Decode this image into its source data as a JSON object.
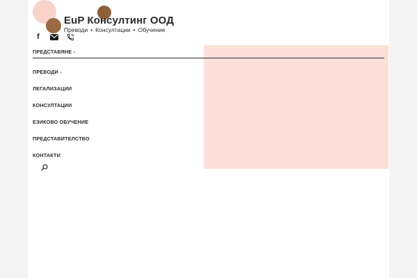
{
  "brand": {
    "title": "EuP Консултинг ООД",
    "tagline_parts": [
      "Преводи",
      "Консултации",
      "Обучение"
    ],
    "tagline_separator": "•",
    "colors": {
      "pink": "#f7d3cc",
      "brown": "#9a6a43"
    }
  },
  "social": [
    {
      "icon": "facebook-icon",
      "glyph": "f"
    },
    {
      "icon": "mail-icon"
    },
    {
      "icon": "phone-icon"
    }
  ],
  "nav": {
    "items": [
      {
        "label": "ПРЕДСТАВЯНЕ",
        "has_dropdown": true,
        "active": true
      },
      {
        "label": "ПРЕВОДИ",
        "has_dropdown": true
      },
      {
        "label": "ЛЕГАЛИЗАЦИИ"
      },
      {
        "label": "КОНСУЛТАЦИИ"
      },
      {
        "label": "ЕЗИКОВО ОБУЧЕНИЕ"
      },
      {
        "label": "ПРЕДСТАВИТЕЛСТВО"
      },
      {
        "label": "КОНТАКТИ"
      }
    ],
    "dropdown_glyph": "⌄",
    "search_icon": "search-icon"
  },
  "hero": {
    "background": "#fde0da"
  }
}
